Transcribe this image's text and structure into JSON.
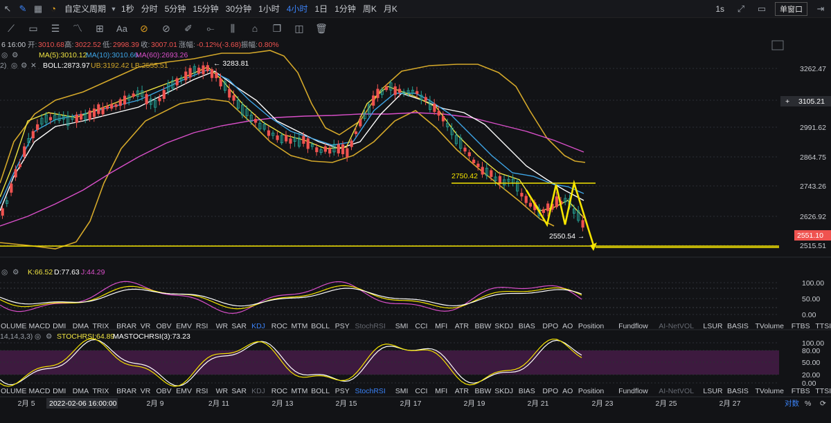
{
  "topbar": {
    "custom_period": "自定义周期",
    "intervals": [
      "1秒",
      "分时",
      "5分钟",
      "15分钟",
      "30分钟",
      "1小时",
      "4小时",
      "1日",
      "1分钟",
      "周K",
      "月K"
    ],
    "active_interval": "4小时",
    "right_interval": "1s",
    "window_mode": "单窗口"
  },
  "info": {
    "time": "6 16:00",
    "open_label": "开:",
    "open": "3010.68",
    "high_label": "高:",
    "high": "3022.52",
    "low_label": "低:",
    "low": "2998.39",
    "close_label": "收:",
    "close": "3007.01",
    "chg_label": "涨幅:",
    "chg": "-0.12%(-3.68)",
    "amp_label": "振幅:",
    "amp": "0.80%",
    "ma5": "MA(5):3010.12",
    "ma10": "MA(10):3010.66",
    "ma60": "MA(60):2693.26",
    "boll": "BOLL:2873.97",
    "ub": "UB:3192.42",
    "lb": "LB:2555.51",
    "row2_prefix": "2)"
  },
  "price_axis": {
    "ticks": [
      "3262.47",
      "3105.21",
      "2991.62",
      "2864.75",
      "2743.26",
      "2626.92",
      "2515.51"
    ],
    "current_price": "2551.10",
    "crosshair_price": "3105.21"
  },
  "annotations": {
    "high_marker": "3283.81",
    "level_2750": "2750.42",
    "low_marker": "2550.54"
  },
  "kdj": {
    "k": "K:66.52",
    "d": "D:77.63",
    "j": "J:44.29",
    "ticks": [
      "100.00",
      "50.00",
      "0.00"
    ]
  },
  "stoch": {
    "prefix": "14,14,3,3)",
    "stochrsi": "STOCHRSI:64.89",
    "mastoch": "MASTOCHRSI(3):73.23",
    "ticks": [
      "100.00",
      "80.00",
      "50.00",
      "20.00",
      "0.00"
    ]
  },
  "indicator_tabs": [
    "OLUME",
    "MACD",
    "DMI",
    "DMA",
    "TRIX",
    "BRAR",
    "VR",
    "OBV",
    "EMV",
    "RSI",
    "WR",
    "SAR",
    "KDJ",
    "ROC",
    "MTM",
    "BOLL",
    "PSY",
    "StochRSI",
    "SMI",
    "CCI",
    "MFI",
    "ATR",
    "BBW",
    "SKDJ",
    "BIAS",
    "DPO",
    "AO",
    "Position",
    "Fundflow",
    "AI-NetVOL",
    "LSUR",
    "BASIS",
    "TVolume",
    "FTBS",
    "TTSI"
  ],
  "tabs_row1_active": "KDJ",
  "tabs_row2_active": "StochRSI",
  "xaxis": {
    "labels": [
      "2月 5",
      "2月 7",
      "2月 9",
      "2月 11",
      "2月 13",
      "2月 15",
      "2月 17",
      "2月 19",
      "2月 21",
      "2月 23",
      "2月 25",
      "2月 27"
    ],
    "crosshair_time": "2022-02-06 16:00:00",
    "log_label": "对数",
    "pct_label": "%"
  },
  "colors": {
    "up": "#26a69a",
    "down": "#ef5350",
    "ma5": "#f0e442",
    "ma10": "#3ea6e8",
    "ma60": "#d94fc9",
    "boll": "#d4a82a",
    "mid": "#ffffff",
    "accent": "#3b82f6",
    "yellow": "#f5e400"
  }
}
